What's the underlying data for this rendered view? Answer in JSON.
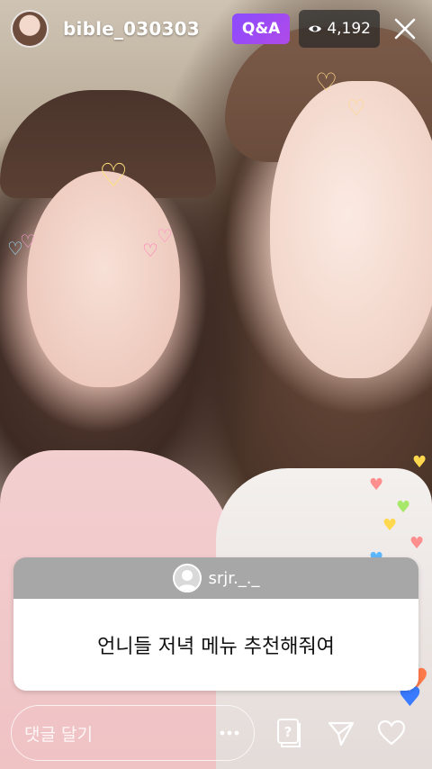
{
  "header": {
    "username": "bible_030303",
    "qa_label": "Q&A",
    "viewer_count": "4,192"
  },
  "question_card": {
    "asker": "srjr._._",
    "question": "언니들 저녁 메뉴 추천해줘여"
  },
  "footer": {
    "comment_placeholder": "댓글 달기"
  },
  "colors": {
    "qa_badge": "#9a4bf5",
    "card_header": "#a8a7a7",
    "viewer_badge_bg": "#282828"
  },
  "icons": {
    "close": "close-icon",
    "eye": "eye-icon",
    "question": "question-box-icon",
    "send": "send-icon",
    "like": "heart-icon",
    "more": "more-icon"
  }
}
